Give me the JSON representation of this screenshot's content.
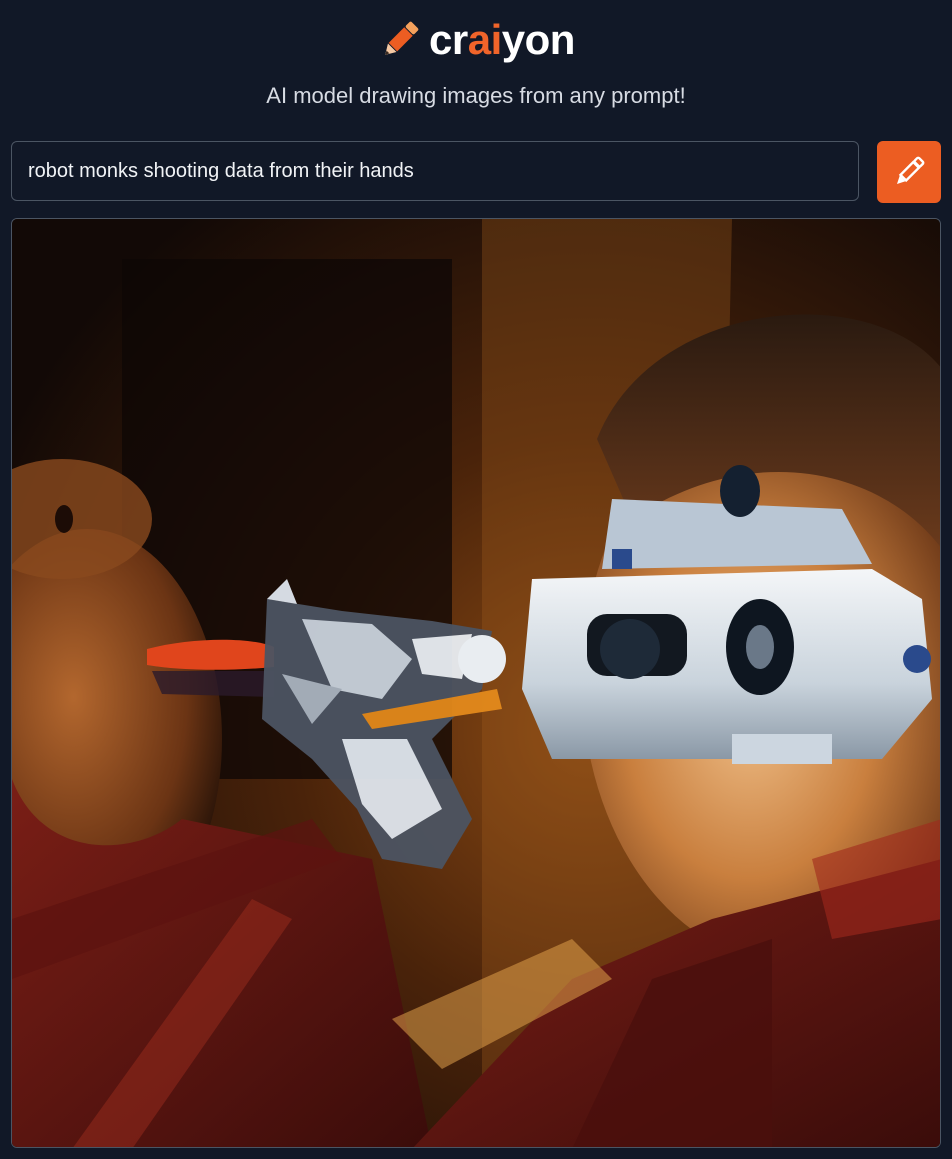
{
  "brand": {
    "name_prefix": "cr",
    "name_accent": "ai",
    "name_suffix": "yon",
    "icon": "pencil-icon",
    "accent_color": "#f0642a"
  },
  "tagline": "AI model drawing images from any prompt!",
  "prompt": {
    "value": "robot monks shooting data from their hands",
    "placeholder": ""
  },
  "draw_button": {
    "icon": "pencil-icon",
    "color": "#ec5d22"
  },
  "result": {
    "icon": "generated-image"
  }
}
